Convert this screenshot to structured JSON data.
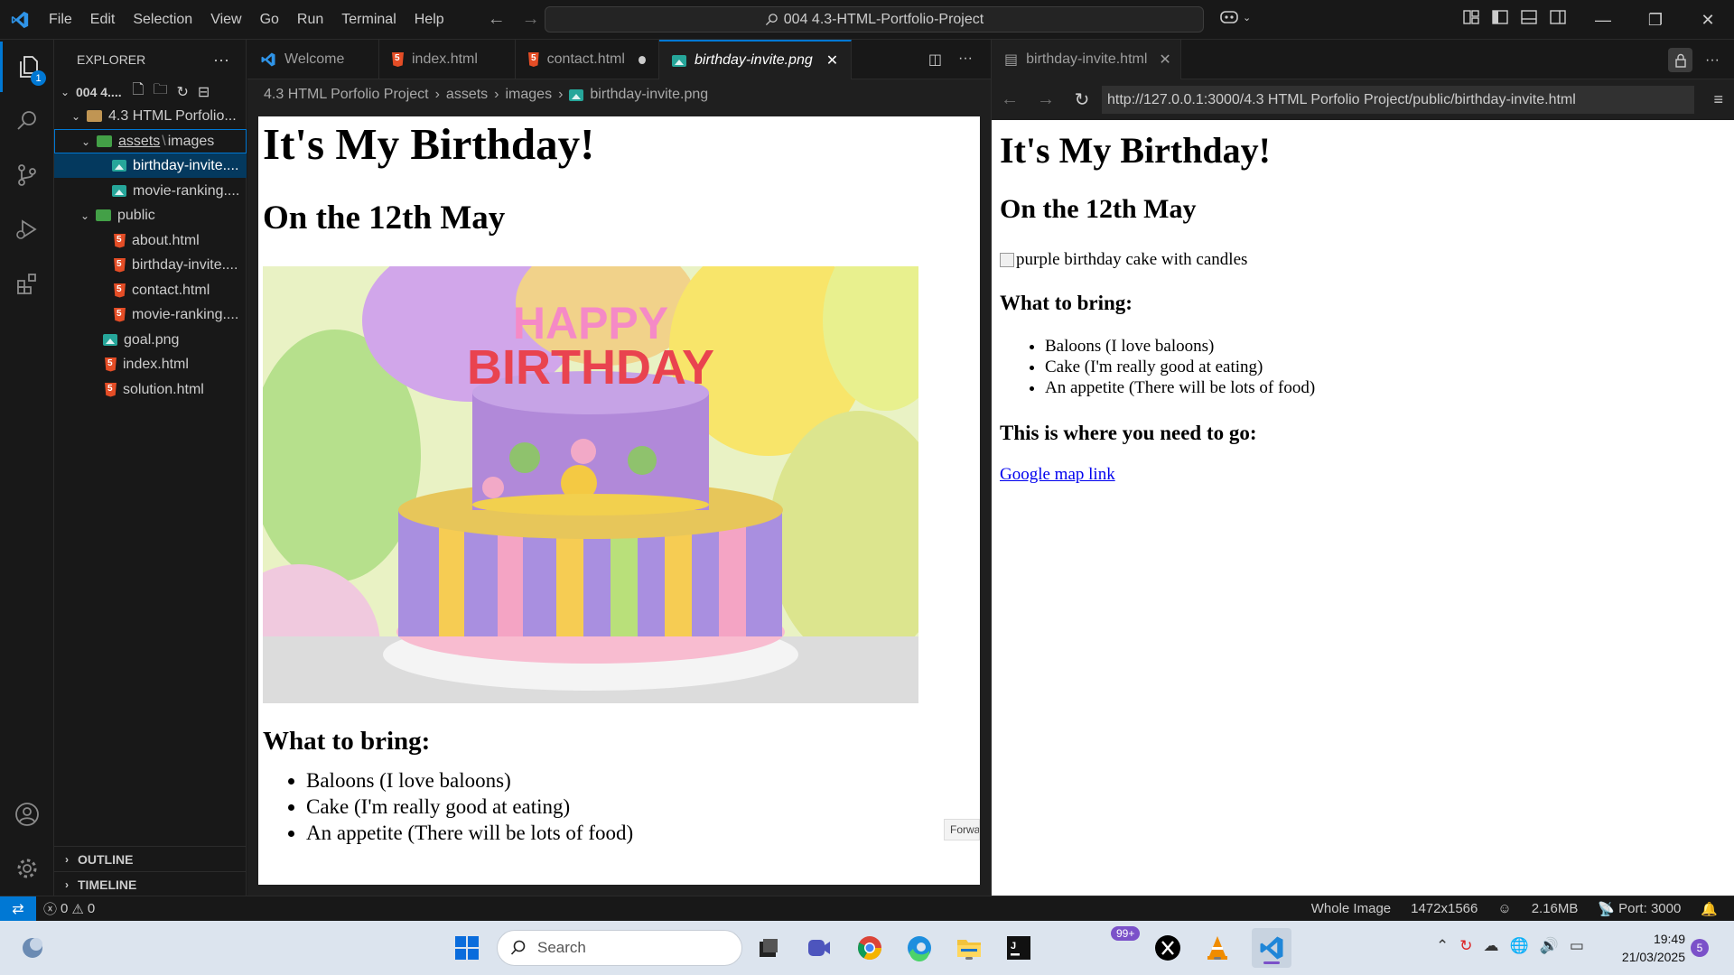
{
  "menu": [
    "File",
    "Edit",
    "Selection",
    "View",
    "Go",
    "Run",
    "Terminal",
    "Help"
  ],
  "command_center": "004 4.3-HTML-Portfolio-Project",
  "explorer": {
    "title": "EXPLORER",
    "workspace": "004 4....",
    "project": "4.3 HTML Porfolio...",
    "assets_label": "assets",
    "images_label": "images",
    "items": [
      {
        "label": "birthday-invite....",
        "type": "image"
      },
      {
        "label": "movie-ranking....",
        "type": "image"
      }
    ],
    "public_label": "public",
    "public_items": [
      "about.html",
      "birthday-invite....",
      "contact.html",
      "movie-ranking...."
    ],
    "root_items": [
      {
        "label": "goal.png",
        "type": "image"
      },
      {
        "label": "index.html",
        "type": "html"
      },
      {
        "label": "solution.html",
        "type": "html"
      }
    ],
    "outline": "OUTLINE",
    "timeline": "TIMELINE"
  },
  "tabs_left": [
    {
      "label": "Welcome"
    },
    {
      "label": "index.html"
    },
    {
      "label": "contact.html"
    },
    {
      "label": "birthday-invite.png"
    }
  ],
  "breadcrumb": [
    "4.3 HTML Porfolio Project",
    "assets",
    "images",
    "birthday-invite.png"
  ],
  "preview_left": {
    "h1": "It's My Birthday!",
    "h2": "On the 12th May",
    "cake_text_1": "HAPPY",
    "cake_text_2": "BIRTHDAY",
    "h3": "What to bring:",
    "items": [
      "Baloons (I love baloons)",
      "Cake (I'm really good at eating)",
      "An appetite (There will be lots of food)"
    ],
    "tooltip": "Forwa"
  },
  "tab_right": "birthday-invite.html",
  "browser": {
    "url": "http://127.0.0.1:3000/4.3 HTML Porfolio Project/public/birthday-invite.html",
    "h1": "It's My Birthday!",
    "h2": "On the 12th May",
    "img_alt": "purple birthday cake with candles",
    "h3_bring": "What to bring:",
    "items": [
      "Baloons (I love baloons)",
      "Cake (I'm really good at eating)",
      "An appetite (There will be lots of food)"
    ],
    "h3_go": "This is where you need to go:",
    "link": "Google map link"
  },
  "status": {
    "errors": "0",
    "warnings": "0",
    "mode": "Whole Image",
    "dimensions": "1472x1566",
    "size": "2.16MB",
    "port": "Port: 3000"
  },
  "taskbar": {
    "search": "Search",
    "badge": "99+",
    "time": "19:49",
    "date": "21/03/2025",
    "notifications": "5"
  },
  "colors": {
    "accent": "#0078d4",
    "html": "#e44d26",
    "image": "#26a69a",
    "link": "#0000ee"
  }
}
